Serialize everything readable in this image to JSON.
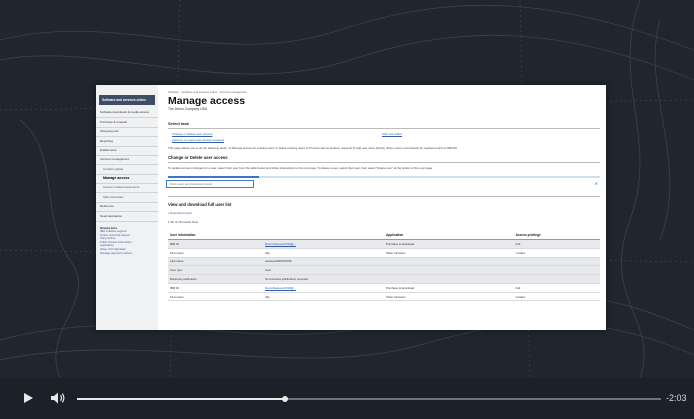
{
  "colors": {
    "brand_header": "#3d4d63",
    "link": "#2f5ea8",
    "search_focus": "#3f7fd0",
    "video_bg": "#1b2128"
  },
  "sidebar": {
    "header": "Software and services online",
    "items": [
      {
        "label": "Software downloads & media access",
        "sub": false,
        "active": false
      },
      {
        "label": "Purchase & renewal",
        "sub": false,
        "active": false
      },
      {
        "label": "Shopping cart",
        "sub": false,
        "active": false
      },
      {
        "label": "Reporting",
        "sub": false,
        "active": false
      },
      {
        "label": "Entitlements",
        "sub": false,
        "active": false
      },
      {
        "label": "Account management",
        "sub": false,
        "active": false
      },
      {
        "label": "Contact update",
        "sub": true,
        "active": false
      },
      {
        "label": "Manage access",
        "sub": true,
        "active": true
      },
      {
        "label": "Account related documents",
        "sub": true,
        "active": false
      },
      {
        "label": "Self-nomination",
        "sub": true,
        "active": false
      },
      {
        "label": "Reference",
        "sub": false,
        "active": false
      },
      {
        "label": "Need assistance",
        "sub": false,
        "active": false
      }
    ],
    "related_title": "Related links",
    "related_links": [
      "IBM software support",
      "Online technical support",
      "Shop Online",
      "Public license information",
      "registration",
      "Value Unit Calculator",
      "Manage payment method"
    ]
  },
  "main": {
    "breadcrumb": "Software  ·  Software and services online  ·  Account management",
    "title": "Manage access",
    "subtitle": "The Demo Company USA",
    "select_task_title": "Select task",
    "task_links": [
      "Change or Delete user access",
      "Add new editor",
      "Approve or reject user access requests"
    ],
    "task_note": "This page allows you to do the following tasks: 1) Manage access for existing users or delete existing users 2) Process self-nomination requests 3) Add new users directly (Note: users must already be registered with an IBM ID)",
    "change_title": "Change or Delete user access",
    "change_instructions": "To update access privileges for a user, select their user from the table below and follow instructions to the next page. To delete a user, select their user, then select \"Delete user\" at the bottom of the next page.",
    "loading_progress": 0.21,
    "search_placeholder": "Find users and download report",
    "clear_glyph": "✕",
    "download_title": "View and download full user list",
    "download_link": "Download report",
    "results_count": "1-50 of 78 results  Next",
    "table": {
      "headers": [
        "User information",
        "",
        "Application",
        "Access privilege"
      ],
      "rows": [
        {
          "band": true,
          "cells": [
            "IBM ID",
            "DemoNewuser2019@...",
            "Purchase & download",
            "Full"
          ]
        },
        {
          "band": false,
          "cells": [
            "First name",
            "Ally",
            "Other functions",
            "Limited"
          ]
        },
        {
          "band": true,
          "cells": [
            "Last name",
            "testuser2020010799",
            "",
            ""
          ]
        },
        {
          "band": true,
          "cells": [
            "User type",
            "User",
            "",
            ""
          ]
        },
        {
          "band": true,
          "cells": [
            "Business justification",
            "No business justification provided",
            "",
            ""
          ]
        },
        {
          "band": false,
          "cells": [
            "IBM ID",
            "DemoNewuser2019@...",
            "Purchase & download",
            "Full"
          ]
        },
        {
          "band": false,
          "cells": [
            "First name",
            "Ally",
            "Other functions",
            "Limited"
          ]
        }
      ]
    }
  },
  "player": {
    "time_remaining": "-2:03",
    "progress": 0.356,
    "play_icon": "play-icon",
    "volume_icon": "volume-icon"
  }
}
